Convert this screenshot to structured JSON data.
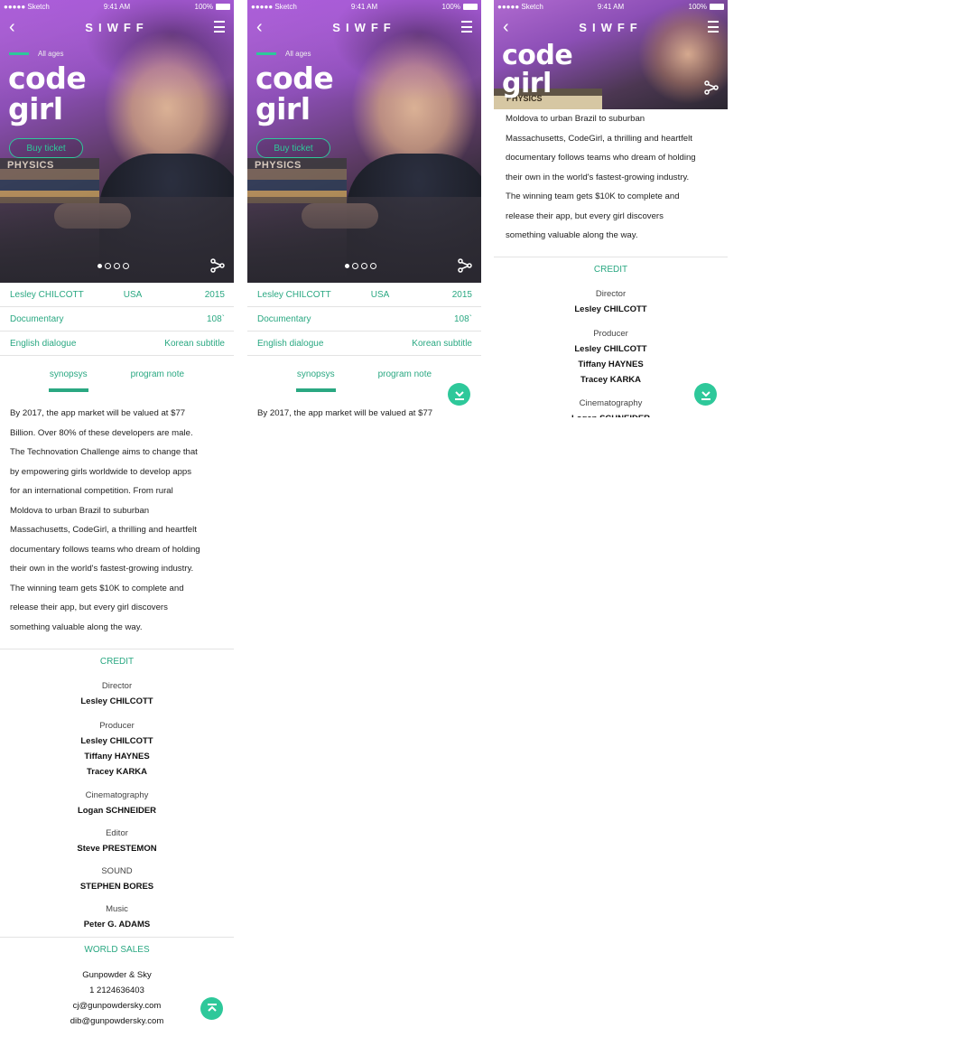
{
  "status": {
    "carrier": "●●●●● Sketch",
    "time": "9:41 AM",
    "battery": "100%"
  },
  "nav": {
    "logo": "SIWFF"
  },
  "hero": {
    "rating": "All ages",
    "title_line1": "code",
    "title_line2": "girl",
    "buy_label": "Buy ticket",
    "books_text": "PHYSICS",
    "carousel_total": 4,
    "carousel_active": 1
  },
  "info": {
    "director": "Lesley CHILCOTT",
    "country": "USA",
    "year": "2015",
    "genre": "Documentary",
    "runtime": "108`",
    "dialogue": "English dialogue",
    "subtitle": "Korean subtitle"
  },
  "tabs": {
    "synopsis": "synopsys",
    "program_note": "program note"
  },
  "synopsis_lines": [
    "By 2017, the app market will be valued at $77",
    "Billion. Over 80% of these developers are male.",
    "The Technovation Challenge aims to change that",
    "by empowering girls worldwide to develop apps",
    "for an international competition. From rural",
    "Moldova to urban Brazil to suburban",
    "Massachusetts, CodeGirl, a thrilling and heartfelt",
    "documentary follows teams who dream of holding",
    "their own in the world's fastest-growing industry.",
    "The winning team gets $10K to complete and",
    "release their app, but every girl discovers",
    "something valuable along the way."
  ],
  "credit": {
    "title": "CREDIT",
    "roles": [
      {
        "role": "Director",
        "names": [
          "Lesley CHILCOTT"
        ]
      },
      {
        "role": "Producer",
        "names": [
          "Lesley CHILCOTT",
          "Tiffany HAYNES",
          "Tracey KARKA"
        ]
      },
      {
        "role": "Cinematography",
        "names": [
          "Logan SCHNEIDER"
        ]
      },
      {
        "role": "Editor",
        "names": [
          "Steve PRESTEMON"
        ]
      },
      {
        "role": "SOUND",
        "names": [
          "STEPHEN BORES"
        ]
      },
      {
        "role": "Music",
        "names": [
          "Peter G. ADAMS"
        ]
      }
    ]
  },
  "world_sales": {
    "title": "WORLD SALES",
    "lines": [
      "Gunpowder & Sky",
      "1 2124636403",
      "cj@gunpowdersky.com",
      "dib@gunpowdersky.com"
    ]
  },
  "colors": {
    "accent": "#2ec89a",
    "accent_text": "#2aa882"
  },
  "icons": [
    "back-arrow-icon",
    "menu-icon",
    "share-icon",
    "scroll-down-icon",
    "scroll-top-icon"
  ]
}
